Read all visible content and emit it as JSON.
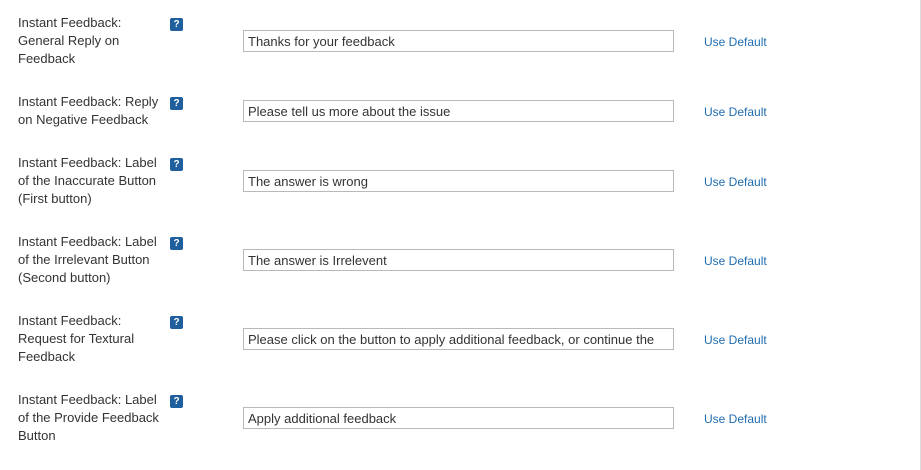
{
  "settings": [
    {
      "label": "Instant Feedback: General Reply on Feedback",
      "value": "Thanks for your feedback",
      "help_icon": "question-mark",
      "use_default": "Use Default"
    },
    {
      "label": "Instant Feedback: Reply on Negative Feedback",
      "value": "Please tell us more about the issue",
      "help_icon": "question-mark",
      "use_default": "Use Default"
    },
    {
      "label": "Instant Feedback: Label of the Inaccurate Button (First button)",
      "value": "The answer is wrong",
      "help_icon": "question-mark",
      "use_default": "Use Default"
    },
    {
      "label": "Instant Feedback: Label of the Irrelevant Button (Second button)",
      "value": "The answer is Irrelevent",
      "help_icon": "question-mark",
      "use_default": "Use Default"
    },
    {
      "label": "Instant Feedback: Request for Textural Feedback",
      "value": "Please click on the button to apply additional feedback, or continue the",
      "help_icon": "question-mark",
      "use_default": "Use Default"
    },
    {
      "label": "Instant Feedback: Label of the Provide Feedback Button",
      "value": "Apply additional feedback",
      "help_icon": "question-mark",
      "use_default": "Use Default"
    }
  ],
  "help_glyph": "?",
  "colors": {
    "help_icon_bg": "#1f5f9e",
    "link": "#1f6cb0",
    "text": "#333333",
    "field_border": "#b9b9b9"
  }
}
